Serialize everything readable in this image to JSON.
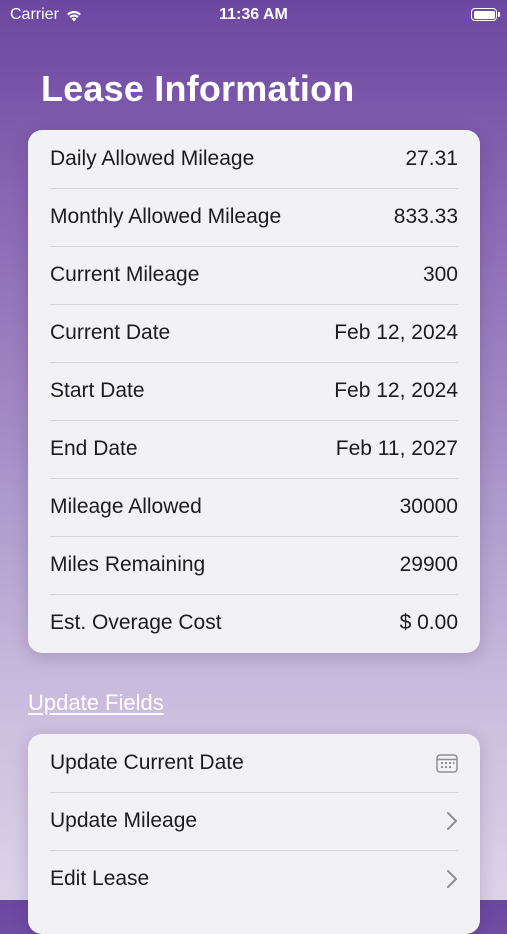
{
  "status_bar": {
    "carrier": "Carrier",
    "time": "11:36 AM"
  },
  "page_title": "Lease Information",
  "info_rows": [
    {
      "label": "Daily Allowed Mileage",
      "value": "27.31"
    },
    {
      "label": "Monthly Allowed Mileage",
      "value": "833.33"
    },
    {
      "label": "Current Mileage",
      "value": "300"
    },
    {
      "label": "Current Date",
      "value": "Feb 12, 2024"
    },
    {
      "label": "Start Date",
      "value": "Feb 12, 2024"
    },
    {
      "label": "End Date",
      "value": "Feb 11, 2027"
    },
    {
      "label": "Mileage Allowed",
      "value": "30000"
    },
    {
      "label": "Miles Remaining",
      "value": "29900"
    },
    {
      "label": "Est. Overage Cost",
      "value": "$ 0.00"
    }
  ],
  "update_section": {
    "header": "Update Fields",
    "items": [
      {
        "label": "Update Current Date",
        "icon": "calendar-icon"
      },
      {
        "label": "Update Mileage",
        "icon": "chevron-right-icon"
      },
      {
        "label": "Edit Lease",
        "icon": "chevron-right-icon"
      }
    ]
  },
  "colors": {
    "background_top": "#6c47a0",
    "background_bottom": "#dcd3e8",
    "card": "#f2f2f5",
    "text": "#1c1c1e"
  }
}
